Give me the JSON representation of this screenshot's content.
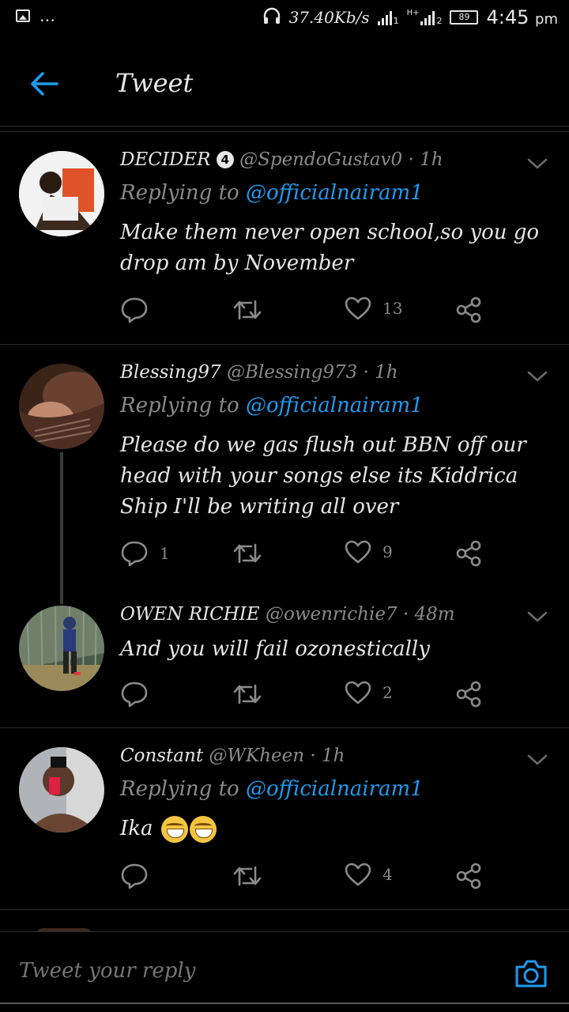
{
  "status": {
    "speed": "37.40Kb/s",
    "sim1": "1",
    "sim2": "2",
    "net_label": "H+",
    "battery": "89",
    "time": "4:45",
    "ampm": "pm"
  },
  "header": {
    "title": "Tweet"
  },
  "tweets": [
    {
      "name": "DECIDER",
      "badge": "4",
      "handle": "@SpendoGustav0 · 1h",
      "replying_prefix": "Replying to ",
      "replying_to": "@officialnairam1",
      "text": "Make them never open school,so you go drop am by November",
      "reply_count": "",
      "like_count": "13"
    },
    {
      "name": "Blessing97",
      "handle": "@Blessing973 · 1h",
      "replying_prefix": "Replying to ",
      "replying_to": "@officialnairam1",
      "text": "Please do we gas flush out BBN off our head with your songs else its Kiddrica Ship I'll be writing all over",
      "reply_count": "1",
      "like_count": "9"
    },
    {
      "name": "OWEN RICHIE",
      "handle": "@owenrichie7 · 48m",
      "text": "And you will fail ozonestically",
      "reply_count": "",
      "like_count": "2"
    },
    {
      "name": "Constant",
      "handle": "@WKheen · 1h",
      "replying_prefix": "Replying to ",
      "replying_to": "@officialnairam1",
      "text": "Ika",
      "reply_count": "",
      "like_count": "4"
    }
  ],
  "reply_bar": {
    "placeholder": "Tweet your reply"
  },
  "colors": {
    "accent": "#1d9bf0",
    "background": "#000000",
    "muted": "#8a8a8a"
  }
}
